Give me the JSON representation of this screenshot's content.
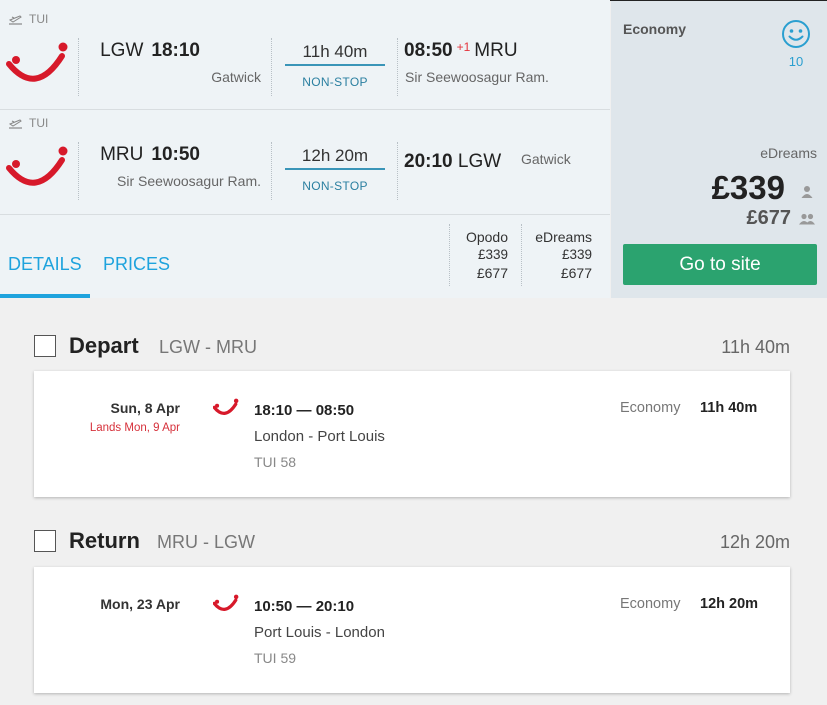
{
  "outbound": {
    "carrier": "TUI",
    "from_code": "LGW",
    "depart_time": "18:10",
    "from_name": "Gatwick",
    "duration": "11h 40m",
    "stops": "NON-STOP",
    "arrive_time": "08:50",
    "day_offset": "+1",
    "to_code": "MRU",
    "to_name": "Sir Seewoosagur Ram."
  },
  "inbound": {
    "carrier": "TUI",
    "from_code": "MRU",
    "depart_time": "10:50",
    "from_name": "Sir Seewoosagur Ram.",
    "duration": "12h 20m",
    "stops": "NON-STOP",
    "arrive_time": "20:10",
    "to_code": "LGW",
    "to_name": "Gatwick"
  },
  "tabs": {
    "details": "DETAILS",
    "prices": "PRICES"
  },
  "price_columns": [
    {
      "provider": "Opodo",
      "price_single": "£339",
      "price_total": "£677"
    },
    {
      "provider": "eDreams",
      "price_single": "£339",
      "price_total": "£677"
    }
  ],
  "side": {
    "cabin": "Economy",
    "score": "10",
    "provider": "eDreams",
    "price_single": "£339",
    "price_total": "£677",
    "cta": "Go to site"
  },
  "depart_section": {
    "title": "Depart",
    "route": "LGW - MRU",
    "duration": "11h 40m",
    "date": "Sun, 8 Apr",
    "lands": "Lands Mon, 9 Apr",
    "times": "18:10 — 08:50",
    "cities": "London - Port Louis",
    "flight": "TUI 58",
    "cabin": "Economy",
    "card_duration": "11h 40m"
  },
  "return_section": {
    "title": "Return",
    "route": "MRU - LGW",
    "duration": "12h 20m",
    "date": "Mon, 23 Apr",
    "times": "10:50 — 20:10",
    "cities": "Port Louis - London",
    "flight": "TUI 59",
    "cabin": "Economy",
    "card_duration": "12h 20m"
  },
  "colors": {
    "accent": "#1ea3dd",
    "cta": "#2ba36f",
    "brand": "#d7192a",
    "alert": "#d6313b"
  },
  "icons": [
    "plane-takeoff-icon",
    "tui-logo",
    "smiley-icon",
    "person-icon",
    "people-icon",
    "checkbox"
  ]
}
